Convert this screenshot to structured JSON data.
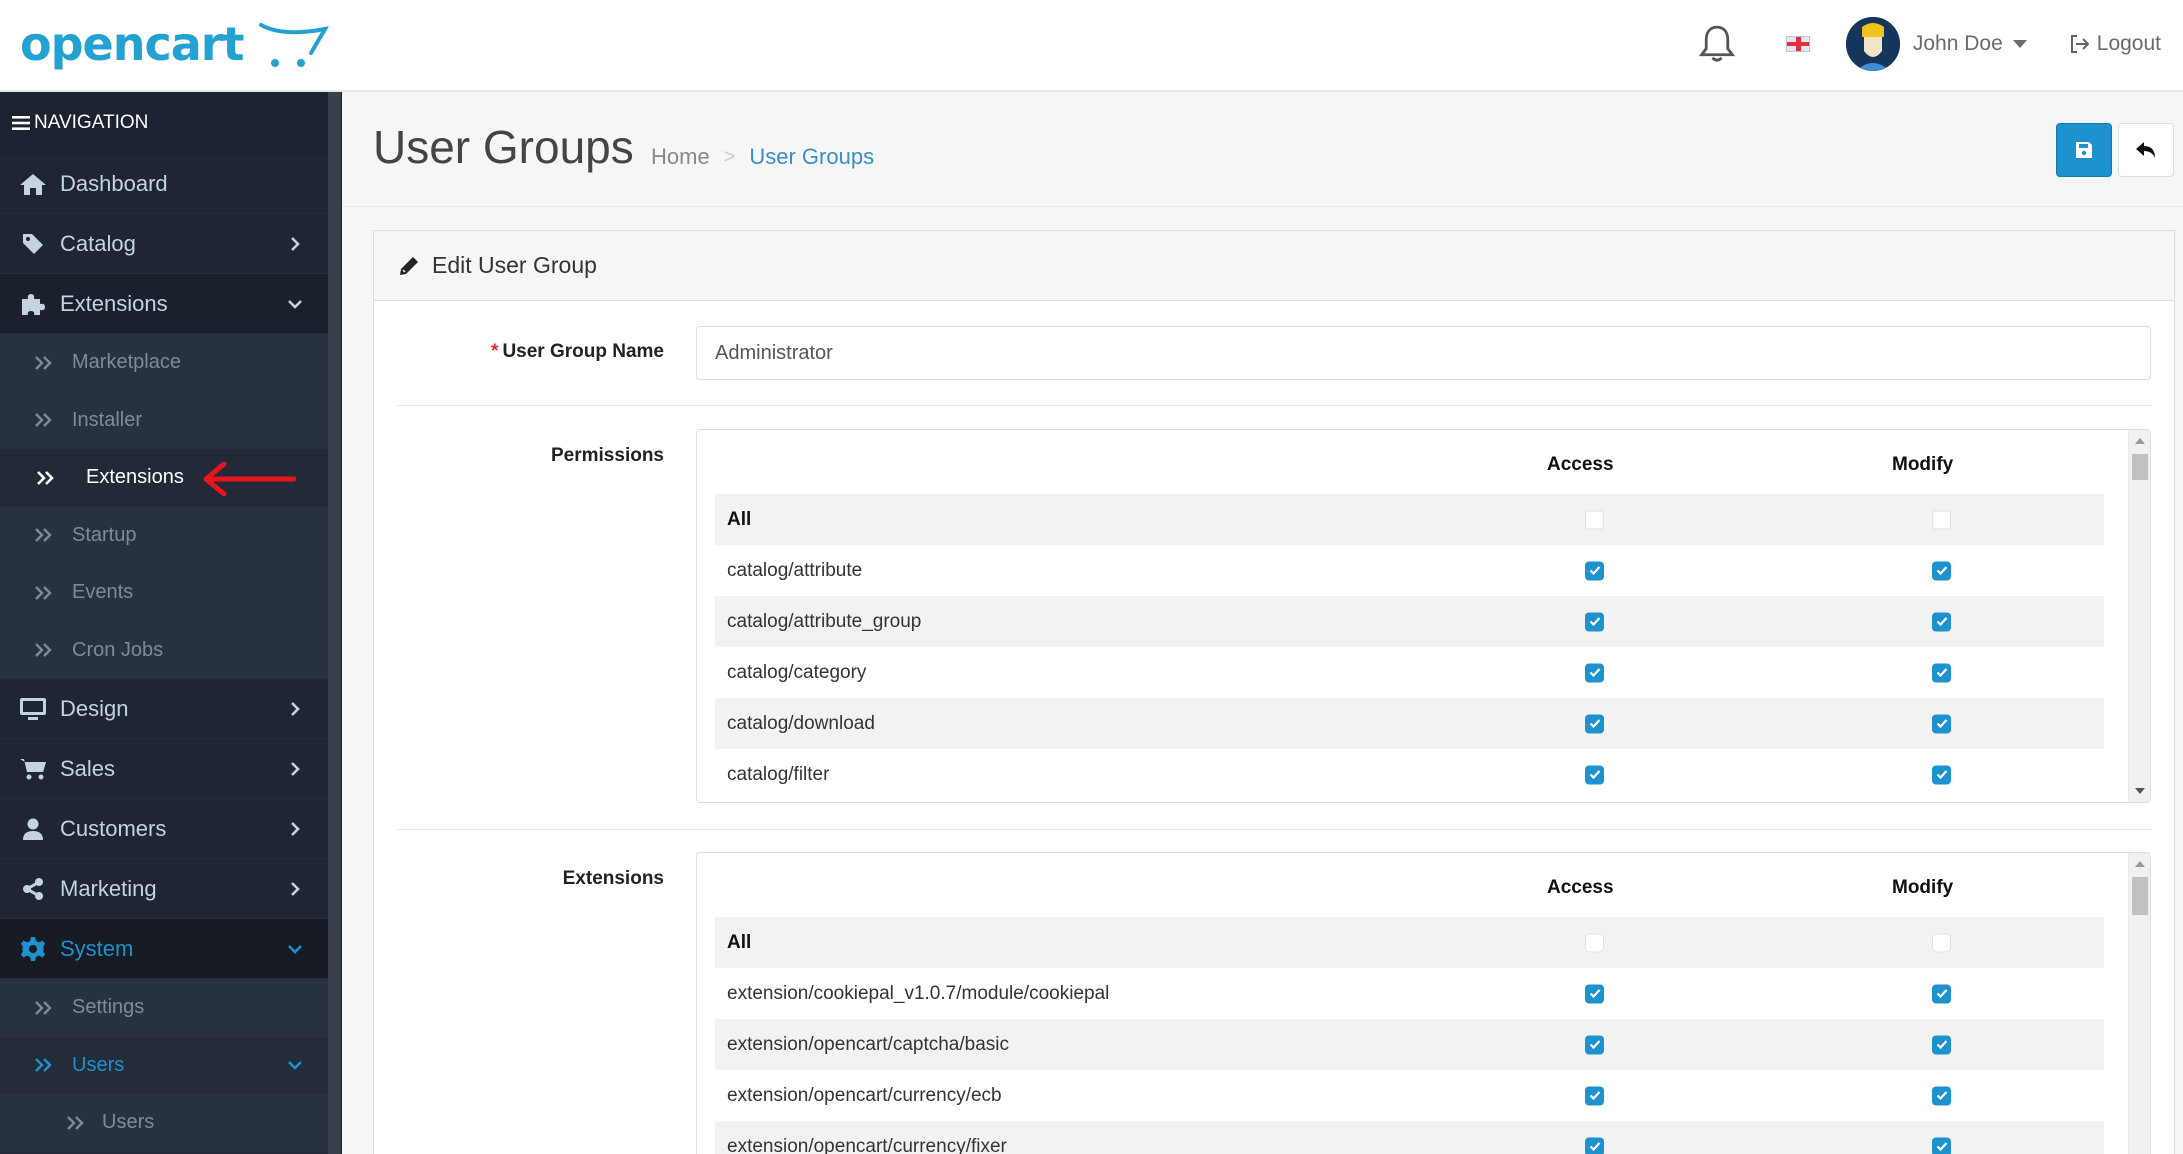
{
  "header": {
    "logo_text": "opencart",
    "user_name": "John Doe",
    "logout_label": "Logout",
    "language": "English (UK)"
  },
  "sidebar": {
    "title": "NAVIGATION",
    "items": [
      {
        "label": "Dashboard",
        "icon": "home-icon"
      },
      {
        "label": "Catalog",
        "icon": "tag-icon"
      },
      {
        "label": "Extensions",
        "icon": "puzzle-icon",
        "expanded": true,
        "children": [
          "Marketplace",
          "Installer",
          "Extensions",
          "Startup",
          "Events",
          "Cron Jobs"
        ],
        "selected_child": "Extensions"
      },
      {
        "label": "Design",
        "icon": "monitor-icon"
      },
      {
        "label": "Sales",
        "icon": "cart-icon"
      },
      {
        "label": "Customers",
        "icon": "user-icon"
      },
      {
        "label": "Marketing",
        "icon": "share-icon"
      },
      {
        "label": "System",
        "icon": "gear-icon",
        "expanded": true,
        "active": true,
        "children": [
          "Settings",
          "Users"
        ],
        "grandchildren": [
          "Users"
        ]
      }
    ]
  },
  "page": {
    "title": "User Groups",
    "breadcrumb": [
      "Home",
      "User Groups"
    ],
    "save_tooltip": "Save",
    "back_tooltip": "Back"
  },
  "panel": {
    "heading": "Edit User Group",
    "name_label": "User Group Name",
    "name_value": "Administrator",
    "permissions": {
      "label": "Permissions",
      "col_access": "Access",
      "col_modify": "Modify",
      "rows": [
        {
          "name": "All",
          "access": false,
          "modify": false
        },
        {
          "name": "catalog/attribute",
          "access": true,
          "modify": true
        },
        {
          "name": "catalog/attribute_group",
          "access": true,
          "modify": true
        },
        {
          "name": "catalog/category",
          "access": true,
          "modify": true
        },
        {
          "name": "catalog/download",
          "access": true,
          "modify": true
        },
        {
          "name": "catalog/filter",
          "access": true,
          "modify": true
        }
      ]
    },
    "extensions": {
      "label": "Extensions",
      "col_access": "Access",
      "col_modify": "Modify",
      "rows": [
        {
          "name": "All",
          "access": false,
          "modify": false
        },
        {
          "name": "extension/cookiepal_v1.0.7/module/cookiepal",
          "access": true,
          "modify": true
        },
        {
          "name": "extension/opencart/captcha/basic",
          "access": true,
          "modify": true
        },
        {
          "name": "extension/opencart/currency/ecb",
          "access": true,
          "modify": true
        },
        {
          "name": "extension/opencart/currency/fixer",
          "access": true,
          "modify": true
        }
      ]
    }
  },
  "colors": {
    "brand": "#23a1d1",
    "primary": "#1e91cf",
    "sidebar_bg": "#252d3c",
    "annotation_arrow": "#e8141c"
  }
}
